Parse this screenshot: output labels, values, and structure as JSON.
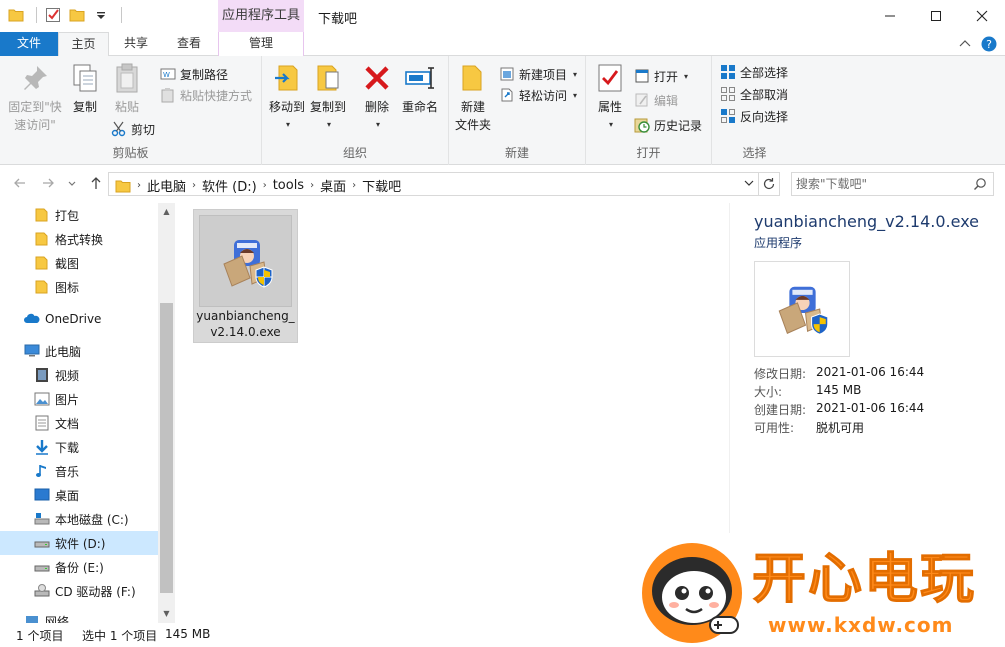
{
  "window": {
    "title": "下载吧",
    "context_tab_header": "应用程序工具"
  },
  "tabs": {
    "file": "文件",
    "home": "主页",
    "share": "共享",
    "view": "查看",
    "manage": "管理"
  },
  "ribbon": {
    "clipboard": {
      "label": "剪贴板",
      "pin": "固定到\"快速访问\"",
      "copy": "复制",
      "paste": "粘贴",
      "copy_path": "复制路径",
      "paste_shortcut": "粘贴快捷方式",
      "cut": "剪切"
    },
    "organize": {
      "label": "组织",
      "move_to": "移动到",
      "copy_to": "复制到",
      "delete": "删除",
      "rename": "重命名"
    },
    "new": {
      "label": "新建",
      "new_folder_line1": "新建",
      "new_folder_line2": "文件夹",
      "new_item": "新建项目",
      "easy_access": "轻松访问"
    },
    "open": {
      "label": "打开",
      "properties": "属性",
      "open": "打开",
      "edit": "编辑",
      "history": "历史记录"
    },
    "select": {
      "label": "选择",
      "select_all": "全部选择",
      "select_none": "全部取消",
      "invert": "反向选择"
    }
  },
  "address": {
    "crumbs": [
      "此电脑",
      "软件 (D:)",
      "tools",
      "桌面",
      "下载吧"
    ],
    "search_placeholder": "搜索\"下载吧\""
  },
  "sidebar": {
    "items": [
      {
        "label": "打包",
        "icon": "folder-icon"
      },
      {
        "label": "格式转换",
        "icon": "folder-icon"
      },
      {
        "label": "截图",
        "icon": "folder-icon"
      },
      {
        "label": "图标",
        "icon": "folder-icon"
      },
      {
        "label": "OneDrive",
        "icon": "onedrive-icon"
      },
      {
        "label": "此电脑",
        "icon": "computer-icon"
      },
      {
        "label": "视频",
        "icon": "video-icon"
      },
      {
        "label": "图片",
        "icon": "pictures-icon"
      },
      {
        "label": "文档",
        "icon": "documents-icon"
      },
      {
        "label": "下载",
        "icon": "download-icon"
      },
      {
        "label": "音乐",
        "icon": "music-icon"
      },
      {
        "label": "桌面",
        "icon": "desktop-icon"
      },
      {
        "label": "本地磁盘 (C:)",
        "icon": "drive-c-icon"
      },
      {
        "label": "软件 (D:)",
        "icon": "drive-icon",
        "selected": true
      },
      {
        "label": "备份 (E:)",
        "icon": "drive-icon"
      },
      {
        "label": "CD 驱动器 (F:)",
        "icon": "cd-drive-icon"
      },
      {
        "label": "网络",
        "icon": "network-icon"
      }
    ]
  },
  "content": {
    "file_name": "yuanbiancheng_v2.14.0.exe"
  },
  "details": {
    "title": "yuanbiancheng_v2.14.0.exe",
    "type": "应用程序",
    "rows": [
      {
        "key": "修改日期:",
        "value": "2021-01-06 16:44"
      },
      {
        "key": "大小:",
        "value": "145 MB"
      },
      {
        "key": "创建日期:",
        "value": "2021-01-06 16:44"
      },
      {
        "key": "可用性:",
        "value": "脱机可用"
      }
    ]
  },
  "status": {
    "count": "1 个项目",
    "selected": "选中 1 个项目",
    "size": "145 MB"
  },
  "watermark": {
    "text": "开心电玩",
    "url": "www.kxdw.com"
  },
  "colors": {
    "file_tab": "#1979ca",
    "context_tab": "#f3dcf7",
    "selection": "#cce8ff",
    "folder": "#f7c842",
    "watermark": "#ff8a1a"
  }
}
